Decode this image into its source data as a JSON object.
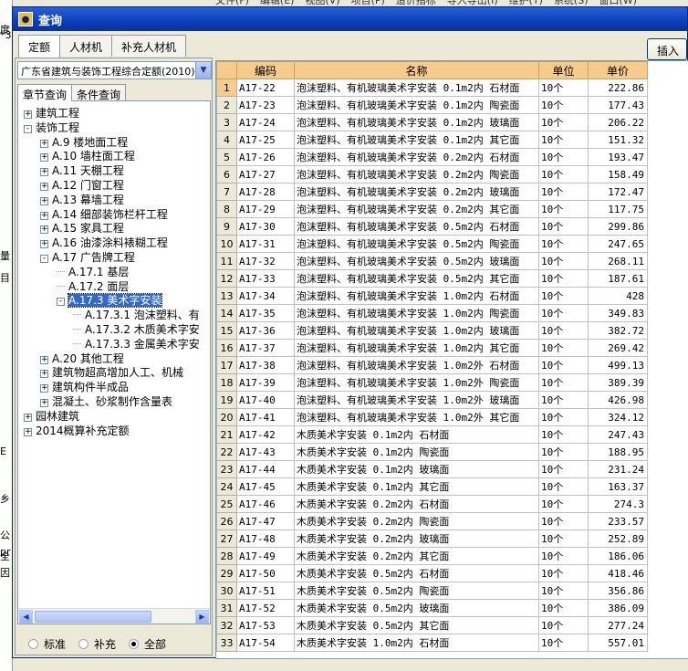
{
  "background": {
    "menu": [
      "文件(F)",
      "编辑(E)",
      "视图(V)",
      "项目(P)",
      "造价指标",
      "导入导出(I)",
      "维护(T)",
      "系统(S)",
      "窗口(W)"
    ],
    "left_fragments": [
      "度",
      "*3",
      "量",
      "目",
      "E",
      "乡",
      "公",
      "pr",
      "全",
      "因"
    ]
  },
  "dialog": {
    "title": "查询",
    "tabs": [
      "定额",
      "人材机",
      "补充人材机"
    ],
    "insert_label": "插入",
    "quota_library": "广东省建筑与装饰工程综合定额(2010)",
    "subtabs": [
      "章节查询",
      "条件查询"
    ],
    "tree": [
      {
        "label": "建筑工程",
        "level": 0,
        "toggle": "+"
      },
      {
        "label": "装饰工程",
        "level": 0,
        "toggle": "-"
      },
      {
        "label": "A.9 楼地面工程",
        "level": 1,
        "toggle": "+"
      },
      {
        "label": "A.10 墙柱面工程",
        "level": 1,
        "toggle": "+"
      },
      {
        "label": "A.11 天棚工程",
        "level": 1,
        "toggle": "+"
      },
      {
        "label": "A.12 门窗工程",
        "level": 1,
        "toggle": "+"
      },
      {
        "label": "A.13 幕墙工程",
        "level": 1,
        "toggle": "+"
      },
      {
        "label": "A.14 细部装饰栏杆工程",
        "level": 1,
        "toggle": "+"
      },
      {
        "label": "A.15 家具工程",
        "level": 1,
        "toggle": "+"
      },
      {
        "label": "A.16 油漆涂料裱糊工程",
        "level": 1,
        "toggle": "+"
      },
      {
        "label": "A.17 广告牌工程",
        "level": 1,
        "toggle": "-"
      },
      {
        "label": "A.17.1 基层",
        "level": 2,
        "toggle": ""
      },
      {
        "label": "A.17.2 面层",
        "level": 2,
        "toggle": ""
      },
      {
        "label": "A.17.3 美术字安装",
        "level": 2,
        "toggle": "-",
        "selected": true
      },
      {
        "label": "A.17.3.1 泡沫塑料、有",
        "level": 3,
        "toggle": ""
      },
      {
        "label": "A.17.3.2 木质美术字安",
        "level": 3,
        "toggle": ""
      },
      {
        "label": "A.17.3.3 金属美术字安",
        "level": 3,
        "toggle": ""
      },
      {
        "label": "A.20 其他工程",
        "level": 1,
        "toggle": "+"
      },
      {
        "label": "建筑物超高增加人工、机械",
        "level": 1,
        "toggle": "+"
      },
      {
        "label": "建筑构件半成品",
        "level": 1,
        "toggle": "+"
      },
      {
        "label": "混凝土、砂浆制作含量表",
        "level": 1,
        "toggle": "+"
      },
      {
        "label": "园林建筑",
        "level": 0,
        "toggle": "+"
      },
      {
        "label": "2014概算补充定额",
        "level": 0,
        "toggle": "+"
      }
    ],
    "filters": [
      {
        "label": "标准",
        "checked": false
      },
      {
        "label": "补充",
        "checked": false
      },
      {
        "label": "全部",
        "checked": true
      }
    ]
  },
  "table": {
    "columns": [
      "编码",
      "名称",
      "单位",
      "单价"
    ],
    "rows": [
      [
        "1",
        "A17-22",
        "泡沫塑料、有机玻璃美术字安装 0.1m2内 石材面",
        "10个",
        "222.86"
      ],
      [
        "2",
        "A17-23",
        "泡沫塑料、有机玻璃美术字安装 0.1m2内 陶瓷面",
        "10个",
        "177.43"
      ],
      [
        "3",
        "A17-24",
        "泡沫塑料、有机玻璃美术字安装 0.1m2内 玻璃面",
        "10个",
        "206.22"
      ],
      [
        "4",
        "A17-25",
        "泡沫塑料、有机玻璃美术字安装 0.1m2内 其它面",
        "10个",
        "151.32"
      ],
      [
        "5",
        "A17-26",
        "泡沫塑料、有机玻璃美术字安装 0.2m2内 石材面",
        "10个",
        "193.47"
      ],
      [
        "6",
        "A17-27",
        "泡沫塑料、有机玻璃美术字安装 0.2m2内 陶瓷面",
        "10个",
        "158.49"
      ],
      [
        "7",
        "A17-28",
        "泡沫塑料、有机玻璃美术字安装 0.2m2内 玻璃面",
        "10个",
        "172.47"
      ],
      [
        "8",
        "A17-29",
        "泡沫塑料、有机玻璃美术字安装 0.2m2内 其它面",
        "10个",
        "117.75"
      ],
      [
        "9",
        "A17-30",
        "泡沫塑料、有机玻璃美术字安装 0.5m2内 石材面",
        "10个",
        "299.86"
      ],
      [
        "10",
        "A17-31",
        "泡沫塑料、有机玻璃美术字安装 0.5m2内 陶瓷面",
        "10个",
        "247.65"
      ],
      [
        "11",
        "A17-32",
        "泡沫塑料、有机玻璃美术字安装 0.5m2内 玻璃面",
        "10个",
        "268.11"
      ],
      [
        "12",
        "A17-33",
        "泡沫塑料、有机玻璃美术字安装 0.5m2内 其它面",
        "10个",
        "187.61"
      ],
      [
        "13",
        "A17-34",
        "泡沫塑料、有机玻璃美术字安装 1.0m2内 石材面",
        "10个",
        "428"
      ],
      [
        "14",
        "A17-35",
        "泡沫塑料、有机玻璃美术字安装 1.0m2内 陶瓷面",
        "10个",
        "349.83"
      ],
      [
        "15",
        "A17-36",
        "泡沫塑料、有机玻璃美术字安装 1.0m2内 玻璃面",
        "10个",
        "382.72"
      ],
      [
        "16",
        "A17-37",
        "泡沫塑料、有机玻璃美术字安装 1.0m2内 其它面",
        "10个",
        "269.42"
      ],
      [
        "17",
        "A17-38",
        "泡沫塑料、有机玻璃美术字安装 1.0m2外 石材面",
        "10个",
        "499.13"
      ],
      [
        "18",
        "A17-39",
        "泡沫塑料、有机玻璃美术字安装 1.0m2外 陶瓷面",
        "10个",
        "389.39"
      ],
      [
        "19",
        "A17-40",
        "泡沫塑料、有机玻璃美术字安装 1.0m2外 玻璃面",
        "10个",
        "426.98"
      ],
      [
        "20",
        "A17-41",
        "泡沫塑料、有机玻璃美术字安装 1.0m2外 其它面",
        "10个",
        "324.12"
      ],
      [
        "21",
        "A17-42",
        "木质美术字安装 0.1m2内 石材面",
        "10个",
        "247.43"
      ],
      [
        "22",
        "A17-43",
        "木质美术字安装 0.1m2内 陶瓷面",
        "10个",
        "188.95"
      ],
      [
        "23",
        "A17-44",
        "木质美术字安装 0.1m2内 玻璃面",
        "10个",
        "231.24"
      ],
      [
        "24",
        "A17-45",
        "木质美术字安装 0.1m2内 其它面",
        "10个",
        "163.37"
      ],
      [
        "25",
        "A17-46",
        "木质美术字安装 0.2m2内 石材面",
        "10个",
        "274.3"
      ],
      [
        "26",
        "A17-47",
        "木质美术字安装 0.2m2内 陶瓷面",
        "10个",
        "233.57"
      ],
      [
        "27",
        "A17-48",
        "木质美术字安装 0.2m2内 玻璃面",
        "10个",
        "252.89"
      ],
      [
        "28",
        "A17-49",
        "木质美术字安装 0.2m2内 其它面",
        "10个",
        "186.06"
      ],
      [
        "29",
        "A17-50",
        "木质美术字安装 0.5m2内 石材面",
        "10个",
        "418.46"
      ],
      [
        "30",
        "A17-51",
        "木质美术字安装 0.5m2内 陶瓷面",
        "10个",
        "356.86"
      ],
      [
        "31",
        "A17-52",
        "木质美术字安装 0.5m2内 玻璃面",
        "10个",
        "386.09"
      ],
      [
        "32",
        "A17-53",
        "木质美术字安装 0.5m2内 其它面",
        "10个",
        "277.24"
      ],
      [
        "33",
        "A17-54",
        "木质美术字安装 1.0m2内 石材面",
        "10个",
        "557.01"
      ]
    ]
  }
}
